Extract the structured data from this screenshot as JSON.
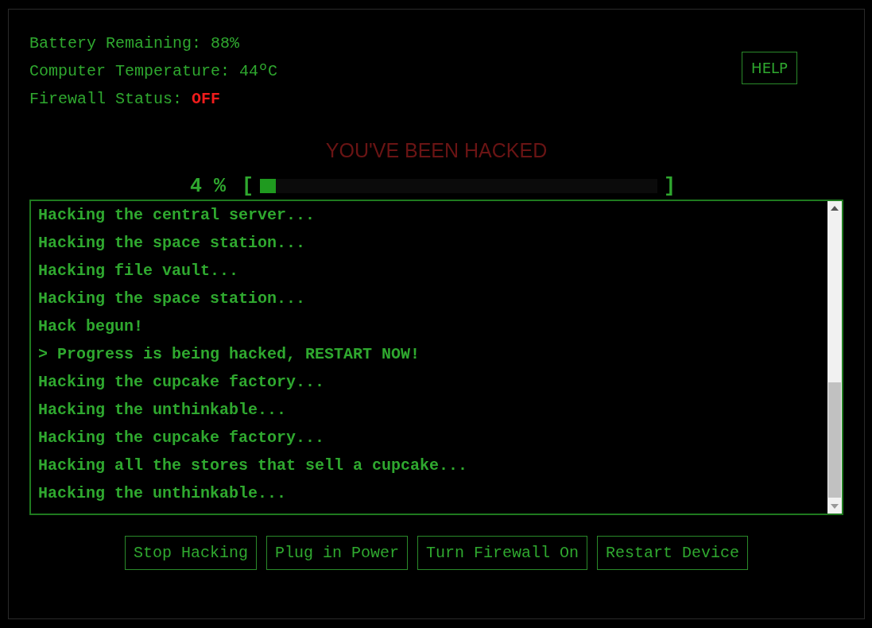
{
  "stats": [
    {
      "label": "Battery Remaining:",
      "value": "88%",
      "alert": false
    },
    {
      "label": "Computer Temperature:",
      "value": "44ºC",
      "alert": false
    },
    {
      "label": "Firewall Status:",
      "value": "OFF",
      "alert": true
    }
  ],
  "help_button": "HELP",
  "banner": "YOU'VE BEEN HACKED",
  "progress": {
    "reading": "4 %",
    "open_bracket": "[",
    "close_bracket": "]",
    "level": 0.04
  },
  "log": [
    "Hacking the central server...",
    "Hacking the space station...",
    "Hacking file vault...",
    "Hacking the space station...",
    "Hack begun!",
    "> Progress is being hacked, RESTART NOW!",
    "Hacking the cupcake factory...",
    "Hacking the unthinkable...",
    "Hacking the cupcake factory...",
    "Hacking all the stores that sell a cupcake...",
    "Hacking the unthinkable..."
  ],
  "buttons": [
    "Stop Hacking",
    "Plug in Power",
    "Turn Firewall On",
    "Restart Device"
  ]
}
